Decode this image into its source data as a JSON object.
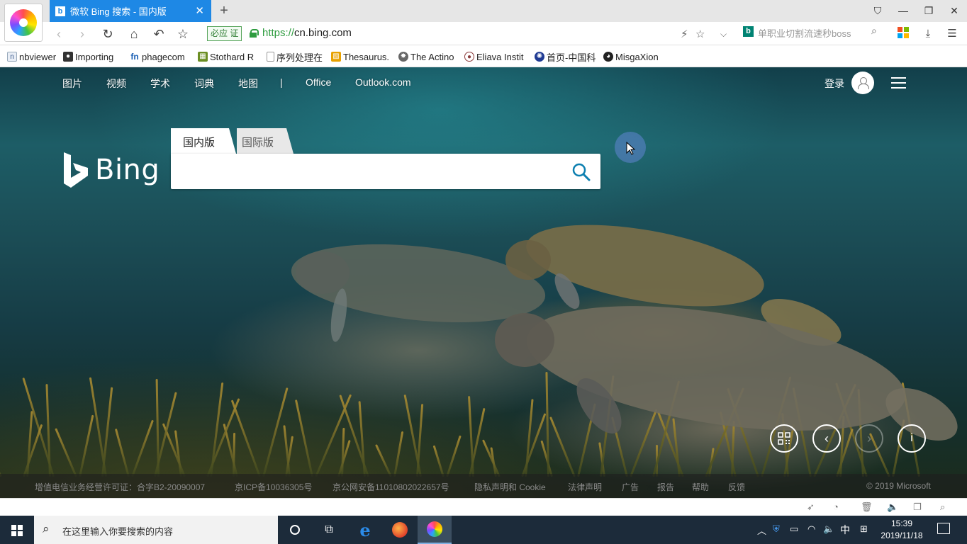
{
  "browser": {
    "active_tab_title": "微软 Bing 搜索 - 国内版",
    "new_tab_symbol": "+",
    "cert_badge": "必应 证",
    "url_scheme": "https://",
    "url_host": "cn.bing.com",
    "search_engine_suggestion": "单职业切割流速秒boss",
    "bookmarks": [
      {
        "label": "nbviewer",
        "icon": "nbviewer-icon",
        "color": "#f37726"
      },
      {
        "label": "Importing",
        "icon": "cat-icon",
        "color": "#333333"
      },
      {
        "label": "phagecom",
        "icon": "fn-icon",
        "color": "#1a5fb4"
      },
      {
        "label": "Stothard R",
        "icon": "stothard-icon",
        "color": "#6b8e23"
      },
      {
        "label": "序列处理在",
        "icon": "page-icon",
        "color": "#999999"
      },
      {
        "label": "Thesaurus.",
        "icon": "thesaurus-icon",
        "color": "#e8a100"
      },
      {
        "label": "The Actino",
        "icon": "actino-icon",
        "color": "#555555"
      },
      {
        "label": "Eliava Instit",
        "icon": "eliava-icon",
        "color": "#8b3a3a"
      },
      {
        "label": "首页-中国科",
        "icon": "cas-icon",
        "color": "#1f3a93"
      },
      {
        "label": "MisgaXion",
        "icon": "github-icon",
        "color": "#222222"
      }
    ]
  },
  "bing": {
    "nav_links": [
      "图片",
      "视频",
      "学术",
      "词典",
      "地图",
      "|",
      "Office",
      "Outlook.com"
    ],
    "login": "登录",
    "logo_word": "Bing",
    "search_tabs": [
      "国内版",
      "国际版"
    ],
    "search_value": "",
    "footer_links": [
      "增值电信业务经营许可证：合字B2-20090007",
      "京ICP备10036305号",
      "京公网安备11010802022657号",
      "隐私声明和 Cookie",
      "法律声明",
      "广告",
      "报告",
      "帮助",
      "反馈"
    ],
    "copyright": "© 2019 Microsoft"
  },
  "taskbar": {
    "search_placeholder": "在这里输入你要搜索的内容",
    "ime": "中",
    "time": "15:39",
    "date": "2019/11/18"
  }
}
